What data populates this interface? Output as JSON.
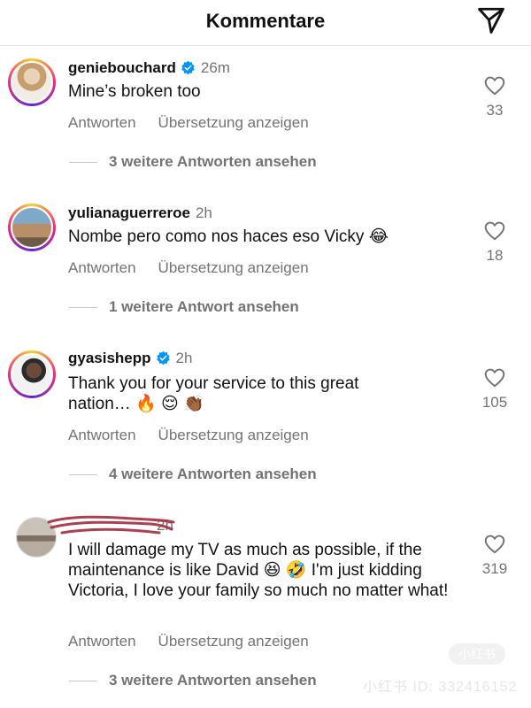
{
  "header": {
    "title": "Kommentare",
    "send_icon": "paper-plane-icon"
  },
  "comments": [
    {
      "username": "geniebouchard",
      "verified": true,
      "time": "26m",
      "text": "Mine’s broken too",
      "reply_label": "Antworten",
      "translate_label": "Übersetzung anzeigen",
      "view_replies": "3 weitere Antworten ansehen",
      "likes": "33"
    },
    {
      "username": "yulianaguerreroe",
      "verified": false,
      "time": "2h",
      "text": "Nombe pero como nos haces eso Vicky 😂",
      "reply_label": "Antworten",
      "translate_label": "Übersetzung anzeigen",
      "view_replies": "1 weitere Antwort ansehen",
      "likes": "18"
    },
    {
      "username": "gyasishepp",
      "verified": true,
      "time": "2h",
      "text": "Thank you for your service to this great nation… 🔥 😌 👏🏾",
      "reply_label": "Antworten",
      "translate_label": "Übersetzung anzeigen",
      "view_replies": "4 weitere Antworten ansehen",
      "likes": "105"
    },
    {
      "username": "",
      "verified": false,
      "time": "2h",
      "text": "I will damage my TV as much as possible, if the maintenance is like David 😆 🤣 I'm just kidding Victoria, I love your family so much no matter what!",
      "reply_label": "Antworten",
      "translate_label": "Übersetzung anzeigen",
      "view_replies": "3 weitere Antworten ansehen",
      "likes": "319"
    }
  ],
  "watermark": {
    "text": "小红书 ID: 332416152",
    "badge": "小红书"
  },
  "colors": {
    "verified": "#0095f6",
    "secondary_text": "#737373"
  }
}
